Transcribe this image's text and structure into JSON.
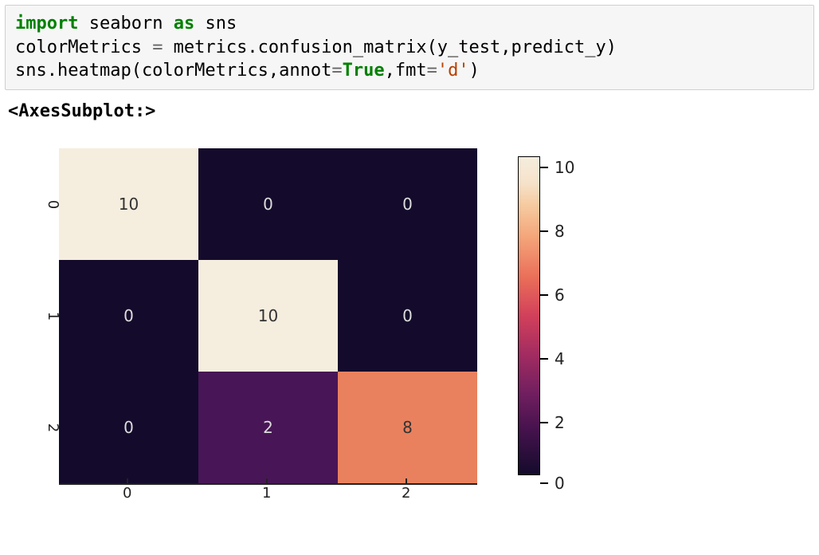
{
  "code": {
    "kw_import": "import",
    "mod": "seaborn",
    "kw_as": "as",
    "alias": "sns",
    "line2_a": "colorMetrics ",
    "line2_eq": "=",
    "line2_b": " metrics.confusion_matrix(y_test,predict_y)",
    "line3_a": "sns.heatmap(colorMetrics,annot",
    "line3_eq1": "=",
    "line3_true": "True",
    "line3_c": ",fmt",
    "line3_eq2": "=",
    "line3_str": "'d'",
    "line3_d": ")"
  },
  "output_text": "<AxesSubplot:>",
  "chart_data": {
    "type": "heatmap",
    "title": "",
    "xlabel": "",
    "ylabel": "",
    "x_categories": [
      "0",
      "1",
      "2"
    ],
    "y_categories": [
      "0",
      "1",
      "2"
    ],
    "matrix": [
      [
        10,
        0,
        0
      ],
      [
        0,
        10,
        0
      ],
      [
        0,
        2,
        8
      ]
    ],
    "colorbar_ticks": [
      "0",
      "2",
      "4",
      "6",
      "8",
      "10"
    ],
    "vmin": 0,
    "vmax": 10,
    "cmap": "rocket"
  },
  "cell_colors": {
    "r0c0": "#f5edde",
    "r0c1": "#140b2c",
    "r0c2": "#140b2c",
    "r1c0": "#140b2c",
    "r1c1": "#f5edde",
    "r1c2": "#140b2c",
    "r2c0": "#140b2c",
    "r2c1": "#481656",
    "r2c2": "#e9815e"
  },
  "cell_text_colors": {
    "r0c0": "#333",
    "r0c1": "#ddd",
    "r0c2": "#ddd",
    "r1c0": "#ddd",
    "r1c1": "#333",
    "r1c2": "#ddd",
    "r2c0": "#ddd",
    "r2c1": "#ddd",
    "r2c2": "#333"
  }
}
